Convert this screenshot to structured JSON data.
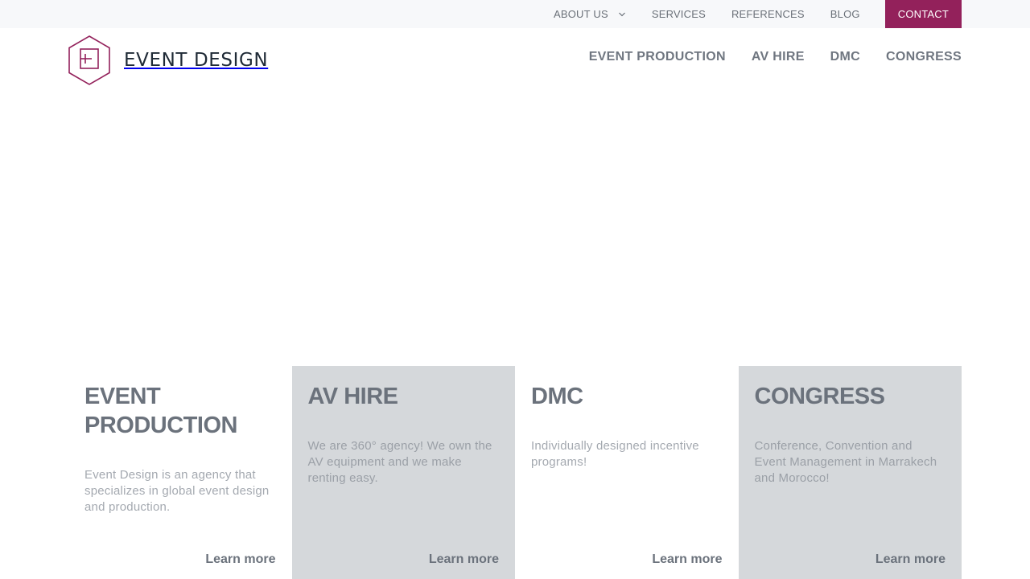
{
  "brand": {
    "name": "EVENT DESIGN",
    "accent_color": "#93215b",
    "text_color": "#1f2a36"
  },
  "topnav": {
    "items": [
      {
        "label": "ABOUT US",
        "has_dropdown": true
      },
      {
        "label": "SERVICES"
      },
      {
        "label": "REFERENCES"
      },
      {
        "label": "BLOG"
      }
    ],
    "contact_label": "CONTACT",
    "dropdown_icon": "chevron-down-icon"
  },
  "mainnav": {
    "items": [
      "EVENT PRODUCTION",
      "AV HIRE",
      "DMC",
      "CONGRESS"
    ]
  },
  "cards": [
    {
      "title": "EVENT PRODUCTION",
      "description": "Event Design is an agency that specializes in global event design and production.",
      "link": "Learn more",
      "shaded": false
    },
    {
      "title": "AV HIRE",
      "description": "We are 360° agency! We own the AV equipment and we make renting easy.",
      "link": "Learn more",
      "shaded": true
    },
    {
      "title": "DMC",
      "description": "Individually designed incentive programs!",
      "link": "Learn more",
      "shaded": false
    },
    {
      "title": "CONGRESS",
      "description": "Conference, Convention and Event Management in Marrakech and Morocco!",
      "link": "Learn more",
      "shaded": true
    }
  ]
}
